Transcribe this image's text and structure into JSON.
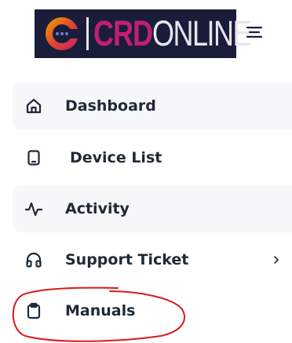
{
  "header": {
    "logo": {
      "text_primary": "CRD",
      "text_secondary": "ONLINE",
      "icon": "crd-logo-mark",
      "background_color": "#1a1d3a",
      "brand_color": "#c1206f"
    },
    "menu_toggle_icon": "hamburger-menu-icon"
  },
  "sidebar": {
    "items": [
      {
        "label": "Dashboard",
        "icon": "home-icon",
        "shaded": true
      },
      {
        "label": "Device List",
        "icon": "tablet-icon",
        "shaded": false
      },
      {
        "label": "Activity",
        "icon": "activity-icon",
        "shaded": true
      },
      {
        "label": "Support Ticket",
        "icon": "headphones-icon",
        "shaded": false,
        "has_submenu": true,
        "submenu_icon": "chevron-right-icon"
      },
      {
        "label": "Manuals",
        "icon": "clipboard-icon",
        "shaded": false,
        "highlighted": true
      }
    ]
  },
  "annotation": {
    "color": "#d81b1b",
    "shape": "hand-drawn-circle",
    "target": "Manuals"
  }
}
